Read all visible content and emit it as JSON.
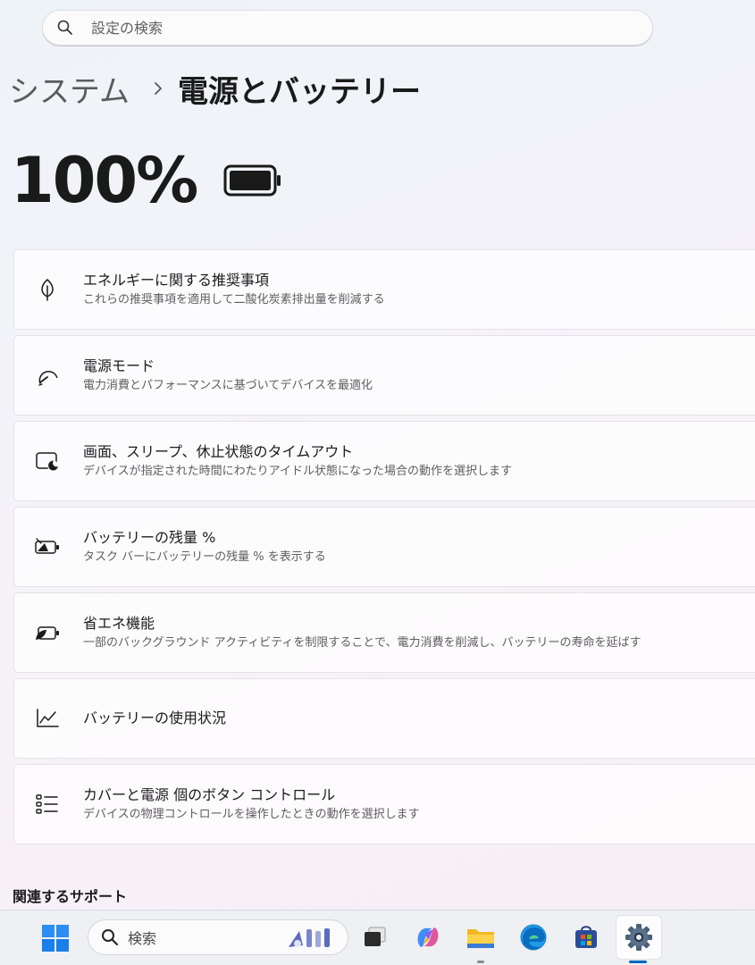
{
  "search": {
    "placeholder": "設定の検索"
  },
  "breadcrumb": {
    "parent": "システム",
    "current": "電源とバッテリー"
  },
  "battery": {
    "percent_text": "100%",
    "level_fraction": 1.0
  },
  "cards": [
    {
      "icon": "leaf-icon",
      "title": "エネルギーに関する推奨事項",
      "subtitle": "これらの推奨事項を適用して二酸化炭素排出量を削減する"
    },
    {
      "icon": "speedometer-icon",
      "title": "電源モード",
      "subtitle": "電力消費とパフォーマンスに基づいてデバイスを最適化"
    },
    {
      "icon": "screen-sleep-icon",
      "title": "画面、スリープ、休止状態のタイムアウト",
      "subtitle": "デバイスが指定された時間にわたりアイドル状態になった場合の動作を選択します"
    },
    {
      "icon": "battery-percent-icon",
      "title": "バッテリーの残量 %",
      "subtitle": "タスク バーにバッテリーの残量 % を表示する"
    },
    {
      "icon": "battery-saver-icon",
      "title": "省エネ機能",
      "subtitle": "一部のバックグラウンド アクティビティを制限することで、電力消費を削減し、バッテリーの寿命を延ばす"
    },
    {
      "icon": "line-chart-icon",
      "title": "バッテリーの使用状況",
      "subtitle": ""
    },
    {
      "icon": "list-icon",
      "title": "カバーと電源 個のボタン コントロール",
      "subtitle": "デバイスの物理コントロールを操作したときの動作を選択します"
    }
  ],
  "related_support": {
    "heading": "関連するサポート"
  },
  "taskbar": {
    "search_label": "検索",
    "apps": [
      "task-view-icon",
      "copilot-icon",
      "file-explorer-icon",
      "edge-icon",
      "store-icon",
      "settings-icon"
    ],
    "colors": {
      "accent": "#0067c0",
      "start_blue": "#1a8cf0"
    }
  }
}
